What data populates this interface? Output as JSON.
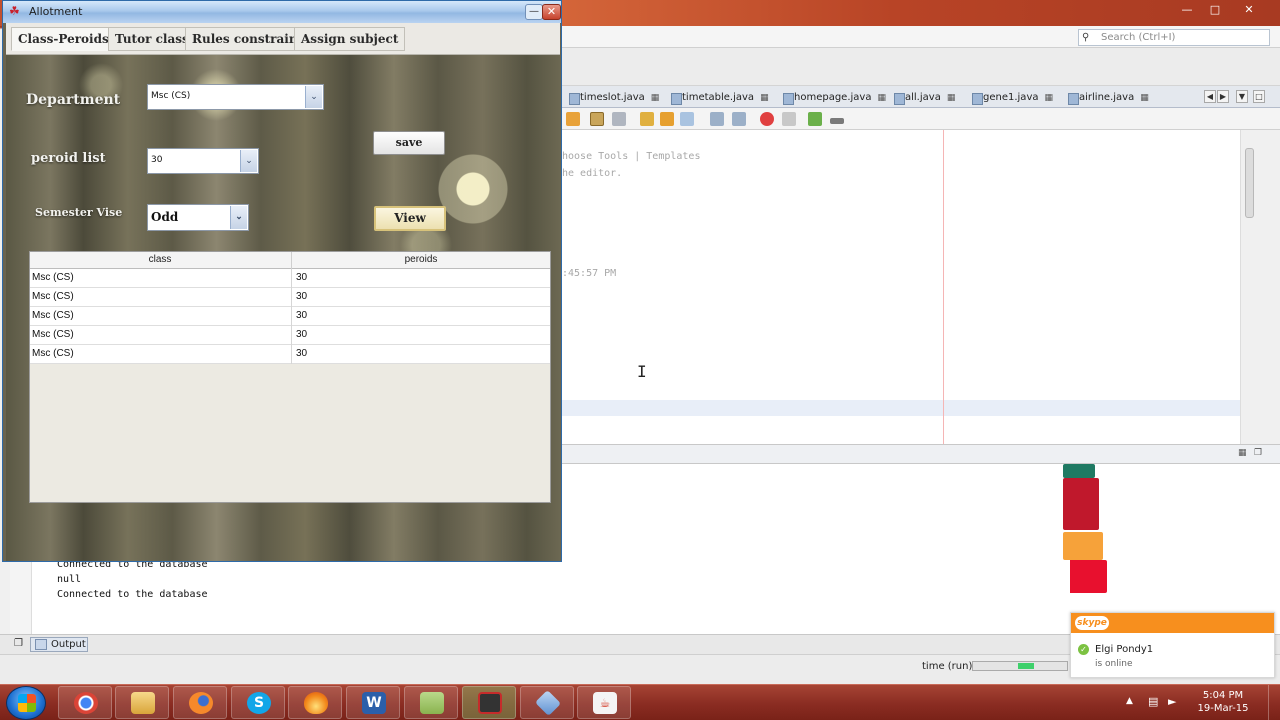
{
  "ide": {
    "search_placeholder": "Search (Ctrl+I)",
    "editor_tabs": [
      "timeslot.java",
      "timetable.java",
      "homepage.java",
      "all.java",
      "gene1.java",
      "airline.java"
    ],
    "code_lines": [
      "hoose Tools | Templates",
      "he editor.",
      ":45:57 PM"
    ],
    "output_lines": [
      "Connected to the database",
      "null",
      "Connected to the database"
    ],
    "output_tab_label": "Output",
    "status_run_label": "time (run)"
  },
  "allotment": {
    "title": "Allotment",
    "tabs": [
      "Class-Peroids",
      "Tutor class",
      "Rules constraint",
      "Assign subject"
    ],
    "active_tab": 0,
    "department_label": "Department",
    "department_value": "Msc (CS)",
    "period_list_label": "peroid list",
    "period_list_value": "30",
    "semester_label": "Semester Vise",
    "semester_value": "Odd",
    "save_label": "save",
    "view_label": "View",
    "table": {
      "columns": [
        "class",
        "peroids"
      ],
      "rows": [
        [
          "Msc (CS)",
          "30"
        ],
        [
          "Msc (CS)",
          "30"
        ],
        [
          "Msc (CS)",
          "30"
        ],
        [
          "Msc (CS)",
          "30"
        ],
        [
          "Msc (CS)",
          "30"
        ]
      ]
    }
  },
  "skype": {
    "logo": "skype",
    "contact_name": "Elgi Pondy1",
    "status_text": "is online"
  },
  "taskbar": {
    "time": "5:04 PM",
    "date": "19-Mar-15",
    "apps": [
      "chrome-icon",
      "explorer-icon",
      "firefox-icon",
      "skype-icon",
      "flame-icon",
      "word-icon",
      "notes-icon",
      "camera-icon",
      "virtualbox-icon",
      "java-icon"
    ]
  },
  "colors": {
    "skype_orange": "#f78f1e",
    "taskbar": "#8a2c22",
    "window_border": "#2e6aa8"
  }
}
